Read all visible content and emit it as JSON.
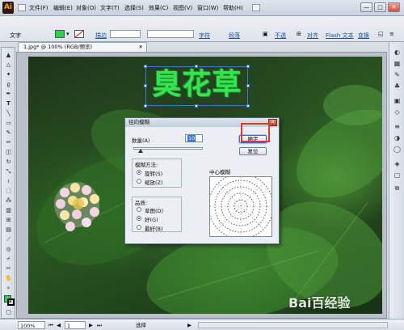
{
  "app": {
    "logo": "Ai"
  },
  "menu": [
    "文件(F)",
    "编辑(E)",
    "对象(O)",
    "文字(T)",
    "选择(S)",
    "效果(C)",
    "视图(V)",
    "窗口(W)",
    "帮助(H)"
  ],
  "window_buttons": {
    "minimize": "—",
    "restore": "□",
    "close": "✕"
  },
  "control_bar": {
    "object_type": "文字",
    "fill_color": "#2bd24a",
    "stroke_label": "描边",
    "char_link": "字符",
    "para_link": "段落",
    "opacity_link": "不透",
    "align_link": "对齐",
    "flash_text": "Flash 文本",
    "transform_link": "变换"
  },
  "document": {
    "tab_title": "1.jpg* @ 100% (RGB/预览)",
    "art_text": "臭花草"
  },
  "dialog": {
    "title": "径向模糊",
    "amount_label": "数量(A)",
    "amount_value": "10",
    "amount_fraction": 0.1,
    "method_label": "模糊方法:",
    "method_options": [
      "旋转(S)",
      "缩放(Z)"
    ],
    "method_selected": 0,
    "quality_label": "品质:",
    "quality_options": [
      "草图(D)",
      "好(G)",
      "最好(B)"
    ],
    "quality_selected": 1,
    "center_label": "中心模糊",
    "ok_label": "确定",
    "reset_label": "复位",
    "close_icon": "✕"
  },
  "status_bar": {
    "zoom": "100%",
    "page": "1",
    "mode": "选择"
  },
  "watermark": "Bai百经验",
  "accent_colors": {
    "highlight_box": "#e0382c",
    "selection": "#3a7bd5"
  }
}
